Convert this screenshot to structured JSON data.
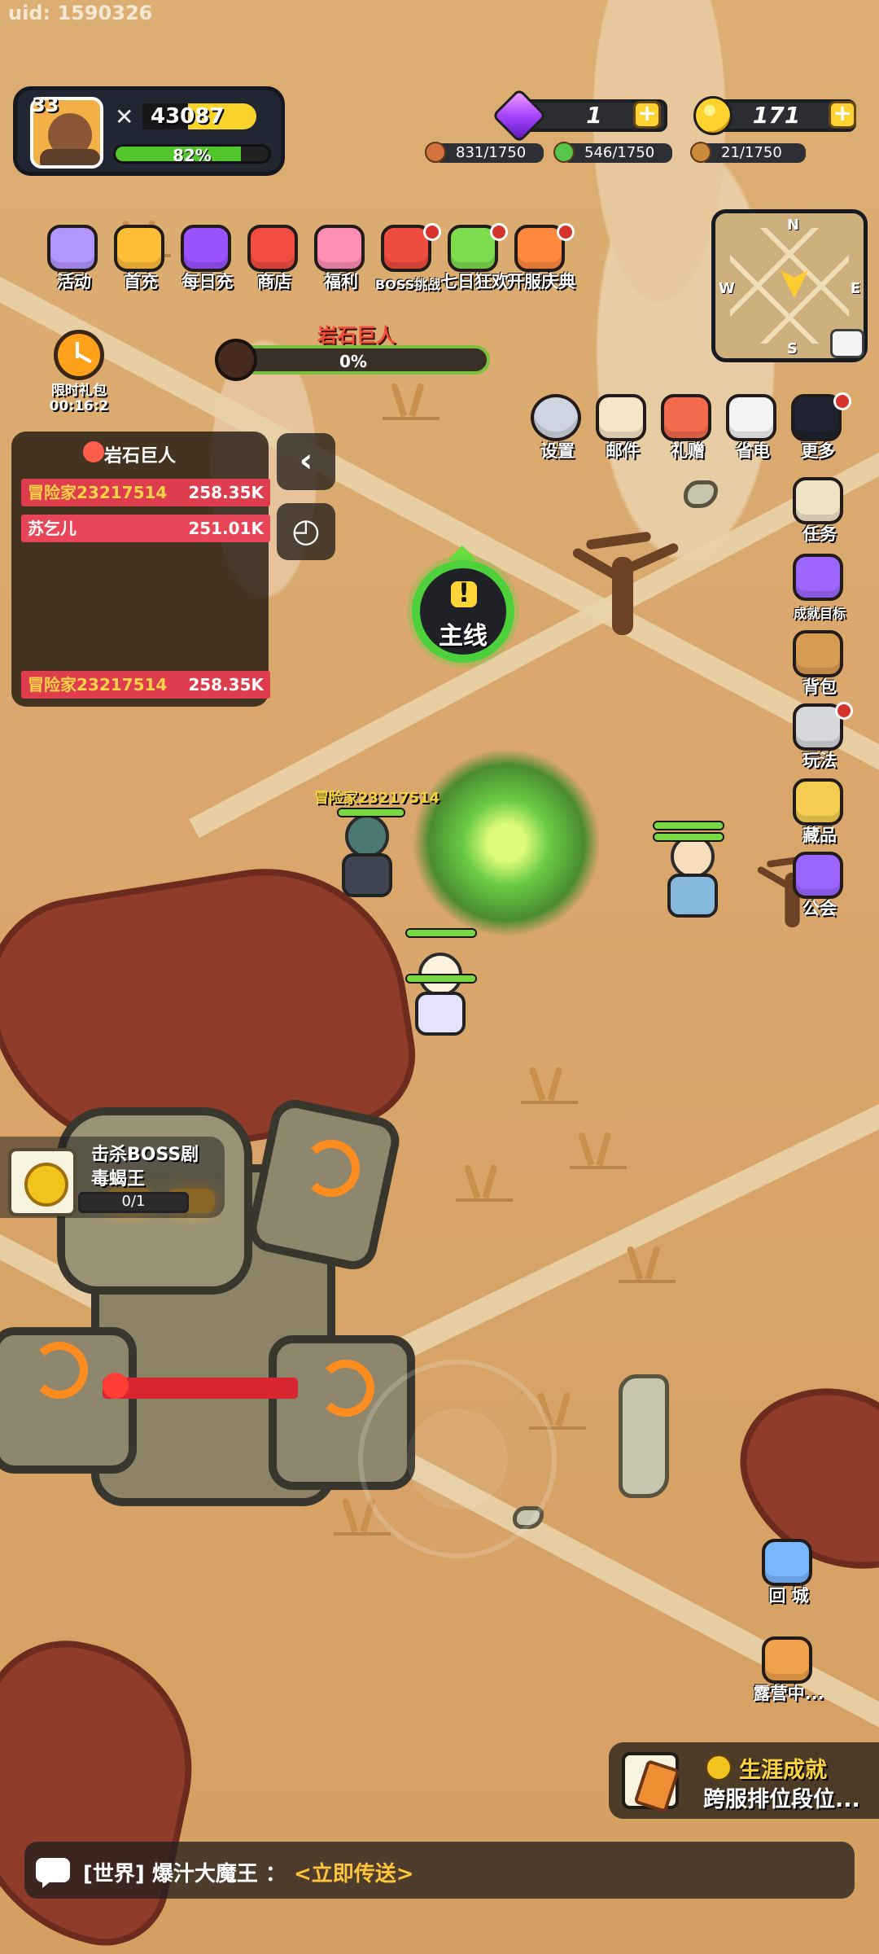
{
  "uid": "uid: 1590326",
  "profile": {
    "level": "33",
    "power": "43087",
    "xp_percent": "82%",
    "xp_fill": 82
  },
  "currencies": {
    "gems": "1",
    "coins": "171"
  },
  "resources": {
    "meat": "831/1750",
    "leaf": "546/1750",
    "ore": "21/1750"
  },
  "top_menu": [
    {
      "label": "活动"
    },
    {
      "label": "首充"
    },
    {
      "label": "每日充"
    },
    {
      "label": "商店"
    },
    {
      "label": "福利"
    },
    {
      "label": "BOSS挑战"
    },
    {
      "label": "七日狂欢"
    },
    {
      "label": "开服庆典"
    }
  ],
  "limited_gift": {
    "label": "限时礼包",
    "timer": "00:16:2"
  },
  "boss_status": {
    "title": "岩石巨人",
    "progress_text": "0%",
    "progress_fill": 0
  },
  "ranking": {
    "title": "岩石巨人",
    "rows": [
      {
        "name": "冒险家23217514",
        "score": "258.35K"
      },
      {
        "name": "苏乞儿",
        "score": "251.01K"
      },
      {
        "name": "冒险家23217514",
        "score": "258.35K"
      }
    ]
  },
  "quick_actions": [
    {
      "label": "设置"
    },
    {
      "label": "邮件"
    },
    {
      "label": "礼赠"
    },
    {
      "label": "省电"
    },
    {
      "label": "更多"
    }
  ],
  "side_menu": [
    {
      "label": "任务"
    },
    {
      "label": "成就目标"
    },
    {
      "label": "背包"
    },
    {
      "label": "玩法"
    },
    {
      "label": "藏品"
    },
    {
      "label": "公会"
    },
    {
      "label": "回 城"
    },
    {
      "label": "露营中..."
    }
  ],
  "main_quest": {
    "label": "主线",
    "mark": "!"
  },
  "player_name": "冒险家23217514",
  "kill_task": {
    "title": "击杀BOSS剧",
    "subtitle": "毒蝎王",
    "progress": "0/1"
  },
  "career": {
    "title": "生涯成就",
    "subtitle": "跨服排位段位..."
  },
  "chat": {
    "channel": "[世界]",
    "speaker": "爆汁大魔王",
    "separator": "：",
    "link": "<立即传送>"
  },
  "minimap": {
    "n": "N",
    "e": "E",
    "s": "S",
    "w": "W"
  },
  "boss_hp_fill": 100
}
